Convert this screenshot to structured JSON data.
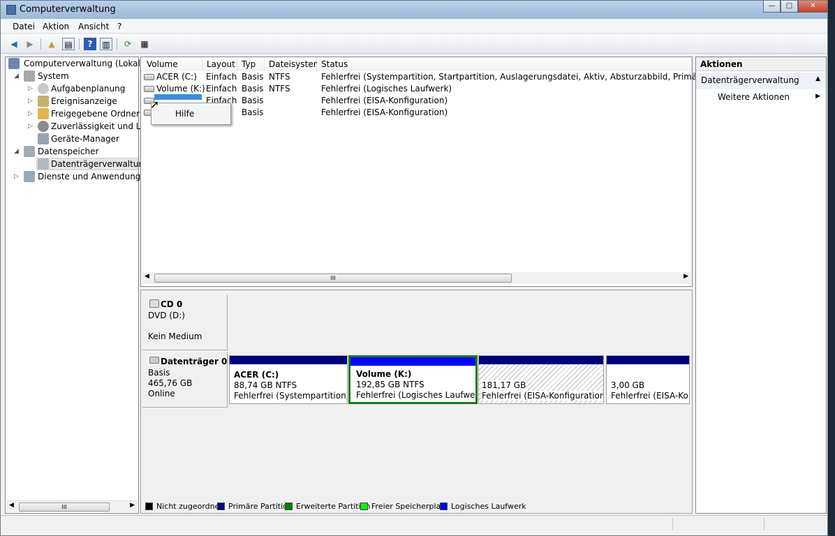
{
  "window": {
    "title": "Computerverwaltung",
    "min": "—",
    "max": "□",
    "close": "✕"
  },
  "menu": [
    "Datei",
    "Aktion",
    "Ansicht",
    "?"
  ],
  "tree": {
    "root": "Computerverwaltung (Lokal)",
    "system": "System",
    "items": [
      "Aufgabenplanung",
      "Ereignisanzeige",
      "Freigegebene Ordner",
      "Zuverlässigkeit und Leis",
      "Geräte-Manager"
    ],
    "storage": "Datenspeicher",
    "diskmgmt": "Datenträgerverwaltung",
    "services": "Dienste und Anwendungen",
    "scroll_thumb": "III"
  },
  "list": {
    "columns": [
      "Volume",
      "Layout",
      "Typ",
      "Dateisystem",
      "Status"
    ],
    "rows": [
      {
        "volume": "ACER (C:)",
        "layout": "Einfach",
        "type": "Basis",
        "fs": "NTFS",
        "status": "Fehlerfrei (Systempartition, Startpartition, Auslagerungsdatei, Aktiv, Absturzabbild, Primäre Partition)"
      },
      {
        "volume": "Volume (K:)",
        "layout": "Einfach",
        "type": "Basis",
        "fs": "NTFS",
        "status": "Fehlerfrei (Logisches Laufwerk)"
      },
      {
        "volume": "",
        "layout": "Einfach",
        "type": "Basis",
        "fs": "",
        "status": "Fehlerfrei (EISA-Konfiguration)"
      },
      {
        "volume": "",
        "layout": "",
        "type": "Basis",
        "fs": "",
        "status": "Fehlerfrei (EISA-Konfiguration)"
      }
    ],
    "scroll_thumb": "III"
  },
  "context_menu": {
    "item": "Hilfe"
  },
  "disks": {
    "cd": {
      "name": "CD 0",
      "type": "DVD (D:)",
      "media": "Kein Medium"
    },
    "disk0": {
      "name": "Datenträger 0",
      "kind": "Basis",
      "size": "465,76 GB",
      "state": "Online"
    },
    "partitions": [
      {
        "name": "ACER  (C:)",
        "size": "88,74 GB NTFS",
        "status": "Fehlerfrei (Systempartition, St"
      },
      {
        "name": "Volume  (K:)",
        "size": "192,85 GB NTFS",
        "status": "Fehlerfrei (Logisches Laufwerk"
      },
      {
        "name": "",
        "size": "181,17 GB",
        "status": "Fehlerfrei (EISA-Konfiguration)"
      },
      {
        "name": "",
        "size": "3,00 GB",
        "status": "Fehlerfrei (EISA-Kon"
      }
    ]
  },
  "legend": [
    {
      "label": "Nicht zugeordnet",
      "color": "#000000"
    },
    {
      "label": "Primäre Partition",
      "color": "#00007f"
    },
    {
      "label": "Erweiterte Partition",
      "color": "#008000"
    },
    {
      "label": "Freier Speicherplatz",
      "color": "#00ff00"
    },
    {
      "label": "Logisches Laufwerk",
      "color": "#0000ff"
    }
  ],
  "actions": {
    "title": "Aktionen",
    "group": "Datenträgerverwaltung",
    "item": "Weitere Aktionen"
  }
}
